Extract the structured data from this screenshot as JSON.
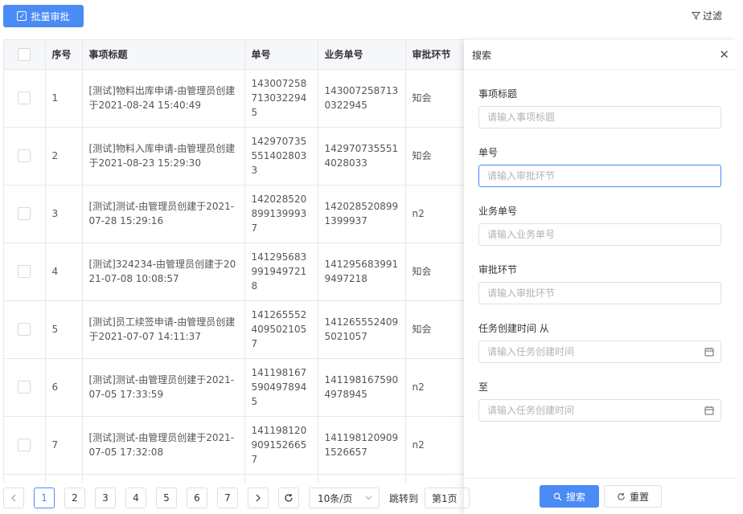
{
  "toolbar": {
    "batch_approve_label": "批量审批",
    "filter_label": "过滤"
  },
  "table": {
    "columns": [
      "序号",
      "事项标题",
      "单号",
      "业务单号",
      "审批环节"
    ],
    "rows": [
      {
        "seq": "1",
        "title": "[测试]物料出库申请-由管理员创建于2021-08-24 15:40:49",
        "no": "1430072587130322945",
        "biz_no": "1430072587130322945",
        "step": "知会"
      },
      {
        "seq": "2",
        "title": "[测试]物料入库申请-由管理员创建于2021-08-23 15:29:30",
        "no": "1429707355514028033",
        "biz_no": "1429707355514028033",
        "step": "知会"
      },
      {
        "seq": "3",
        "title": "[测试]测试-由管理员创建于2021-07-28 15:29:16",
        "no": "1420285208991399937",
        "biz_no": "1420285208991399937",
        "step": "n2"
      },
      {
        "seq": "4",
        "title": "[测试]324234-由管理员创建于2021-07-08 10:08:57",
        "no": "1412956839919497218",
        "biz_no": "1412956839919497218",
        "step": "知会"
      },
      {
        "seq": "5",
        "title": "[测试]员工续签申请-由管理员创建于2021-07-07 14:11:37",
        "no": "1412655524095021057",
        "biz_no": "1412655524095021057",
        "step": "知会"
      },
      {
        "seq": "6",
        "title": "[测试]测试-由管理员创建于2021-07-05 17:33:59",
        "no": "1411981675904978945",
        "biz_no": "1411981675904978945",
        "step": "n2"
      },
      {
        "seq": "7",
        "title": "[测试]测试-由管理员创建于2021-07-05 17:32:08",
        "no": "1411981209091526657",
        "biz_no": "1411981209091526657",
        "step": "n2"
      }
    ]
  },
  "search_panel": {
    "title": "搜索",
    "fields": [
      {
        "label": "事项标题",
        "placeholder": "请输入事项标题"
      },
      {
        "label": "单号",
        "placeholder": "请输入审批环节"
      },
      {
        "label": "业务单号",
        "placeholder": "请输入业务单号"
      },
      {
        "label": "审批环节",
        "placeholder": "请输入审批环节"
      },
      {
        "label": "任务创建时间 从",
        "placeholder": "请输入任务创建时间"
      },
      {
        "label": "至",
        "placeholder": "请输入任务创建时间"
      }
    ],
    "search_label": "搜索",
    "reset_label": "重置"
  },
  "pagination": {
    "pages": [
      "1",
      "2",
      "3",
      "4",
      "5",
      "6",
      "7"
    ],
    "current": "1",
    "page_size": "10条/页",
    "jump_label": "跳转到",
    "jump_value": "第1页"
  },
  "colors": {
    "primary": "#4b8bf5",
    "border": "#dcdfe6"
  }
}
